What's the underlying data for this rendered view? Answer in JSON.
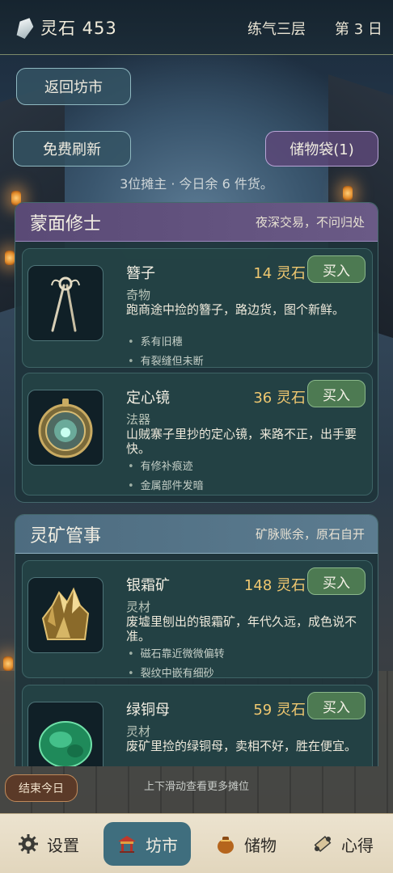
{
  "topbar": {
    "spirit_stones": "灵石 453",
    "realm": "练气三层",
    "day": "第 3 日"
  },
  "actions": {
    "back": "返回坊市",
    "refresh": "免费刷新",
    "bag": "储物袋(1)"
  },
  "hint": "3位摊主 · 今日余 6 件货。",
  "sellers": [
    {
      "name": "蒙面修士",
      "motto": "夜深交易，不问归处",
      "items": [
        {
          "name": "簪子",
          "price": "14 灵石",
          "buy": "买入",
          "category": "奇物",
          "desc": "跑商途中捡的簪子，路边货，图个新鲜。",
          "traits": [
            "系有旧穗",
            "有裂缝但未断"
          ],
          "icon": "hairpin-icon"
        },
        {
          "name": "定心镜",
          "price": "36 灵石",
          "buy": "买入",
          "category": "法器",
          "desc": "山贼寨子里抄的定心镜，来路不正，出手要快。",
          "traits": [
            "有修补痕迹",
            "金属部件发暗"
          ],
          "icon": "mirror-icon"
        }
      ]
    },
    {
      "name": "灵矿管事",
      "motto": "矿脉账余，原石自开",
      "items": [
        {
          "name": "银霜矿",
          "price": "148 灵石",
          "buy": "买入",
          "category": "灵材",
          "desc": "废墟里刨出的银霜矿，年代久远，成色说不准。",
          "traits": [
            "磁石靠近微微偏转",
            "裂纹中嵌有细砂"
          ],
          "icon": "ore-icon"
        },
        {
          "name": "绿铜母",
          "price": "59 灵石",
          "buy": "买入",
          "category": "灵材",
          "desc": "废矿里捡的绿铜母，卖相不好，胜在便宜。",
          "traits": [],
          "icon": "green-ore-icon"
        }
      ]
    }
  ],
  "scroll_hint": "上下滑动查看更多摊位",
  "end_day": "结束今日",
  "nav": {
    "settings": "设置",
    "market": "坊市",
    "storage": "储物",
    "notes": "心得"
  }
}
